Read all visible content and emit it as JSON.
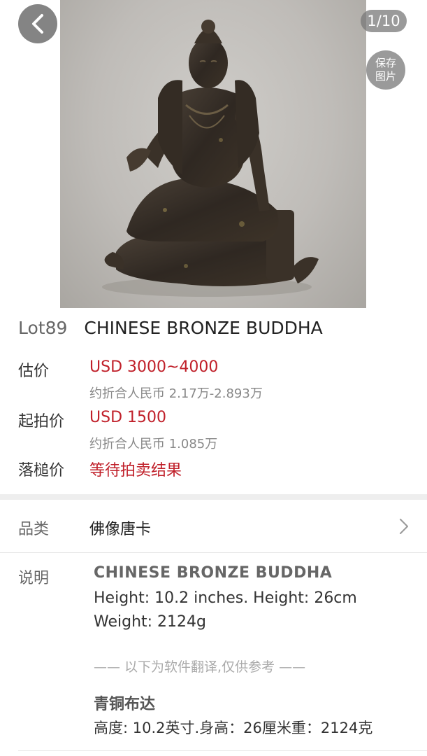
{
  "gallery": {
    "counter": "1/10",
    "save_label_line1": "保存",
    "save_label_line2": "图片",
    "back_icon": "chevron-left-icon"
  },
  "lot": {
    "number": "Lot89",
    "title": "CHINESE BRONZE BUDDHA"
  },
  "estimate": {
    "label": "估价",
    "value": "USD 3000~4000",
    "rmb": "约折合人民币 2.17万-2.893万"
  },
  "start_price": {
    "label": "起拍价",
    "value": "USD 1500",
    "rmb": "约折合人民币 1.085万"
  },
  "hammer_price": {
    "label": "落槌价",
    "value": "等待拍卖结果"
  },
  "category": {
    "label": "品类",
    "value": "佛像唐卡",
    "icon": "chevron-right-icon"
  },
  "description": {
    "label": "说明",
    "title": "CHINESE BRONZE BUDDHA",
    "line1": "Height: 10.2 inches. Height: 26cm",
    "line2": "Weight: 2124g",
    "translation_note": "—— 以下为软件翻译,仅供参考 ——",
    "cn_title": "青铜布达",
    "cn_line": "高度: 10.2英寸.身高：26厘米重：2124克"
  },
  "colors": {
    "accent_red": "#c0202a",
    "muted": "#888888",
    "divider": "#eeeeee"
  }
}
